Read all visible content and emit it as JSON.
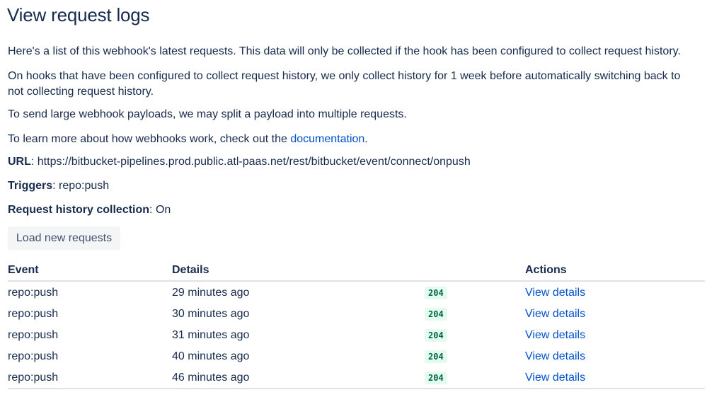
{
  "page": {
    "title": "View request logs",
    "paragraphs": {
      "intro": "Here's a list of this webhook's latest requests. This data will only be collected if the hook has been configured to collect request history.",
      "history": "On hooks that have been configured to collect request history, we only collect history for 1 week before automatically switching back to not collecting request history.",
      "split": "To send large webhook payloads, we may split a payload into multiple requests.",
      "learn_prefix": "To learn more about how webhooks work, check out the ",
      "learn_link": "documentation",
      "learn_suffix": "."
    },
    "fields": {
      "url_label": "URL",
      "url_value": "https://bitbucket-pipelines.prod.public.atl-paas.net/rest/bitbucket/event/connect/onpush",
      "triggers_label": "Triggers",
      "triggers_value": "repo:push",
      "history_label": "Request history collection",
      "history_value": "On"
    },
    "load_button": "Load new requests"
  },
  "table": {
    "headers": {
      "event": "Event",
      "details": "Details",
      "actions": "Actions"
    },
    "rows": [
      {
        "event": "repo:push",
        "details": "29 minutes ago",
        "status": "204",
        "action": "View details"
      },
      {
        "event": "repo:push",
        "details": "30 minutes ago",
        "status": "204",
        "action": "View details"
      },
      {
        "event": "repo:push",
        "details": "31 minutes ago",
        "status": "204",
        "action": "View details"
      },
      {
        "event": "repo:push",
        "details": "40 minutes ago",
        "status": "204",
        "action": "View details"
      },
      {
        "event": "repo:push",
        "details": "46 minutes ago",
        "status": "204",
        "action": "View details"
      }
    ]
  },
  "colors": {
    "text": "#172b4d",
    "link": "#0052cc",
    "badge_bg": "#e3fcef",
    "badge_text": "#006644",
    "button_bg": "#f4f5f7"
  }
}
